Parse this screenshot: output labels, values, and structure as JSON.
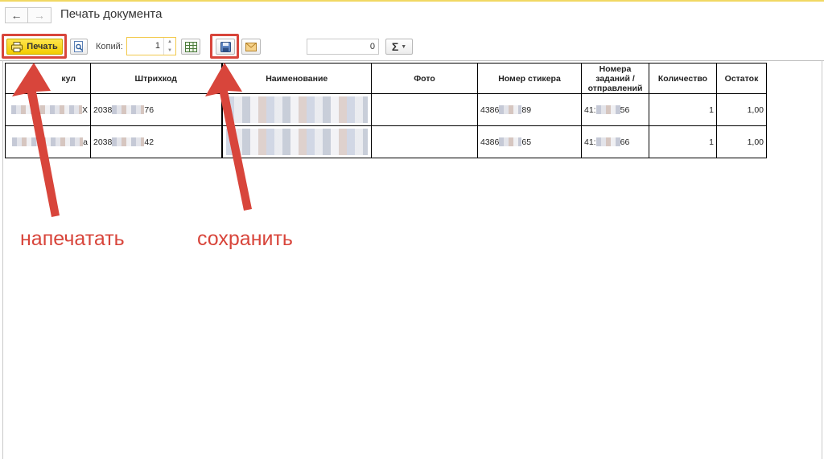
{
  "window": {
    "title": "Печать документа"
  },
  "nav": {
    "back_glyph": "←",
    "forward_glyph": "→"
  },
  "toolbar": {
    "print_label": "Печать",
    "copies_label": "Копий:",
    "copies_value": "1",
    "sum_value": "0",
    "sum_glyph": "Σ",
    "icons": [
      "printer-icon",
      "preview-icon",
      "table-settings-icon",
      "save-icon",
      "mail-icon",
      "sum-icon"
    ]
  },
  "table": {
    "headers": [
      "Артикул",
      "Штрихкод",
      "Наименование",
      "Фото",
      "Номер стикера",
      "Номера заданий / отправлений",
      "Количество",
      "Остаток"
    ],
    "header_article_visible": "кул",
    "rows": [
      {
        "article_tail": "X",
        "barcode_prefix": "2038",
        "barcode_suffix": "76",
        "sticker_prefix": "4386",
        "sticker_suffix": "89",
        "task_prefix": "41:",
        "task_suffix": "56",
        "quantity": "1",
        "remainder": "1,00"
      },
      {
        "article_tail": "a",
        "barcode_prefix": "2038",
        "barcode_suffix": "42",
        "sticker_prefix": "4386",
        "sticker_suffix": "65",
        "task_prefix": "41:",
        "task_suffix": "66",
        "quantity": "1",
        "remainder": "1,00"
      }
    ]
  },
  "annotations": {
    "print_label": "напечатать",
    "save_label": "сохранить",
    "color": "#d8453b"
  }
}
